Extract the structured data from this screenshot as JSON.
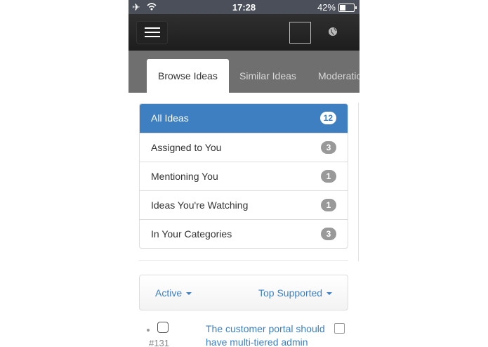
{
  "status_bar": {
    "time": "17:28",
    "battery": "42%",
    "battery_level": 0.42
  },
  "header": {
    "menu_icon": "hamburger-icon",
    "globe_icon": "globe-icon"
  },
  "tabs": [
    {
      "label": "Browse Ideas",
      "active": true
    },
    {
      "label": "Similar Ideas",
      "active": false
    },
    {
      "label": "Moderation",
      "active": false
    }
  ],
  "filters": [
    {
      "label": "All Ideas",
      "count": "12",
      "active": true
    },
    {
      "label": "Assigned to You",
      "count": "3",
      "active": false
    },
    {
      "label": "Mentioning You",
      "count": "1",
      "active": false
    },
    {
      "label": "Ideas You're Watching",
      "count": "1",
      "active": false
    },
    {
      "label": "In Your Categories",
      "count": "3",
      "active": false
    }
  ],
  "sort_bar": {
    "status_label": "Active",
    "sort_label": "Top Supported"
  },
  "ideas": [
    {
      "number": "#131",
      "title": "The customer portal should have multi-tiered admin"
    }
  ],
  "colors": {
    "accent": "#3d7fc1",
    "header": "#222222",
    "tabbar": "#6f6f6f"
  }
}
